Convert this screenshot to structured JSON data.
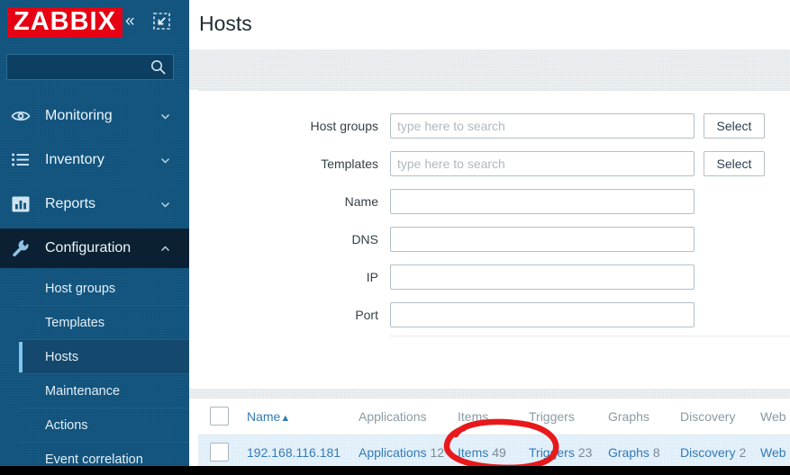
{
  "brand": {
    "logo_text": "ZABBIX",
    "logo_bg": "#e60013",
    "sidebar_bg": "#12547d"
  },
  "sidebar": {
    "collapse_icon": "chevron-double-left-icon",
    "kiosk_icon": "kiosk-mode-icon",
    "search": {
      "value": "",
      "placeholder": ""
    },
    "nav": [
      {
        "label": "Monitoring",
        "icon": "eye-icon",
        "expanded": false,
        "active": false
      },
      {
        "label": "Inventory",
        "icon": "list-icon",
        "expanded": false,
        "active": false
      },
      {
        "label": "Reports",
        "icon": "bar-chart-icon",
        "expanded": false,
        "active": false
      },
      {
        "label": "Configuration",
        "icon": "wrench-icon",
        "expanded": true,
        "active": true
      }
    ],
    "submenu": [
      {
        "label": "Host groups",
        "active": false
      },
      {
        "label": "Templates",
        "active": false
      },
      {
        "label": "Hosts",
        "active": true
      },
      {
        "label": "Maintenance",
        "active": false
      },
      {
        "label": "Actions",
        "active": false
      },
      {
        "label": "Event correlation",
        "active": false
      }
    ]
  },
  "header": {
    "title": "Hosts"
  },
  "filter": {
    "rows": [
      {
        "label": "Host groups",
        "value": "",
        "placeholder": "type here to search",
        "input_width": 338,
        "select": "Select"
      },
      {
        "label": "Templates",
        "value": "",
        "placeholder": "type here to search",
        "input_width": 338,
        "select": "Select"
      },
      {
        "label": "Name",
        "value": "",
        "placeholder": "",
        "input_width": 338,
        "select": ""
      },
      {
        "label": "DNS",
        "value": "",
        "placeholder": "",
        "input_width": 338,
        "select": ""
      },
      {
        "label": "IP",
        "value": "",
        "placeholder": "",
        "input_width": 338,
        "select": ""
      },
      {
        "label": "Port",
        "value": "",
        "placeholder": "",
        "input_width": 338,
        "select": ""
      }
    ]
  },
  "table": {
    "select_all_checkbox": false,
    "columns": [
      {
        "label": "Name",
        "sorted": true,
        "sort_dir": "▲"
      },
      {
        "label": "Applications",
        "sorted": false,
        "sort_dir": ""
      },
      {
        "label": "Items",
        "sorted": false,
        "sort_dir": ""
      },
      {
        "label": "Triggers",
        "sorted": false,
        "sort_dir": ""
      },
      {
        "label": "Graphs",
        "sorted": false,
        "sort_dir": ""
      },
      {
        "label": "Discovery",
        "sorted": false,
        "sort_dir": ""
      },
      {
        "label": "Web",
        "sorted": false,
        "sort_dir": ""
      }
    ],
    "rows": [
      {
        "checked": false,
        "name": "192.168.116.181",
        "applications": {
          "label": "Applications",
          "count": "12"
        },
        "items": {
          "label": "Items",
          "count": "49"
        },
        "triggers": {
          "label": "Triggers",
          "count": "23"
        },
        "graphs": {
          "label": "Graphs",
          "count": "8"
        },
        "discovery": {
          "label": "Discovery",
          "count": "2"
        },
        "web": {
          "label": "Web",
          "count": ""
        }
      }
    ]
  },
  "annotation": {
    "shape": "ellipse",
    "color": "#e8191b",
    "targets": "Items 49"
  }
}
